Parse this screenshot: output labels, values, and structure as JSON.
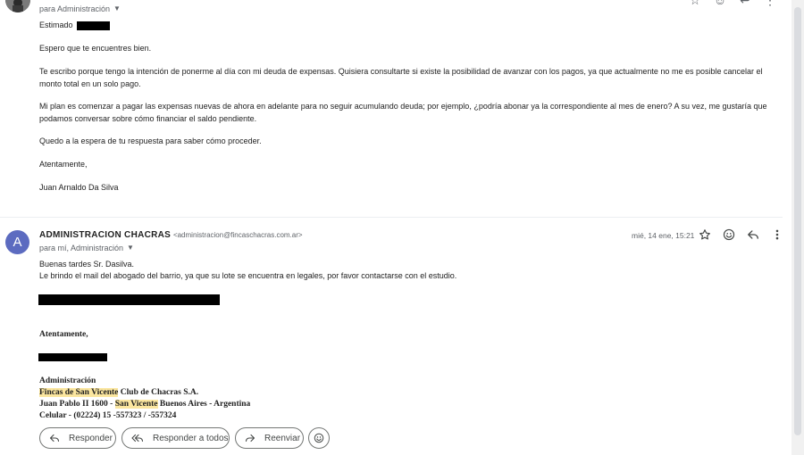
{
  "message1": {
    "recipients_label": "para Administración",
    "greeting": "Estimado",
    "paragraphs": [
      "Espero que te encuentres bien.",
      "Te escribo porque tengo la intención de ponerme al día con mi deuda de expensas. Quisiera consultarte si existe la posibilidad de avanzar con los pagos, ya que actualmente no me es posible cancelar el monto total en un solo pago.",
      "Mi plan es comenzar a pagar las expensas nuevas de ahora en adelante para no seguir acumulando deuda; por ejemplo, ¿podría abonar ya la correspondiente al mes de enero? A su vez, me gustaría que podamos conversar sobre cómo financiar el saldo pendiente.",
      "Quedo a la espera de tu respuesta para saber cómo proceder.",
      "Atentamente,",
      "Juan Arnaldo Da Silva"
    ]
  },
  "message2": {
    "avatar_letter": "A",
    "sender_name": "ADMINISTRACION CHACRAS",
    "sender_email": "<administracion@fincaschacras.com.ar>",
    "recipients_label": "para mí, Administración",
    "date": "mié, 14 ene, 15:21",
    "body_line1": "Buenas tardes Sr. Dasilva.",
    "body_line2": "Le brindo el mail del abogado del barrio, ya que su lote se encuentra en legales, por favor contactarse con el estudio.",
    "closing": "Atentamente,",
    "signature": {
      "title": "Administración",
      "line2_highlight": "Fincas de San Vicente",
      "line2_rest": " Club de Chacras S.A.",
      "line3_start": "Juan Pablo II 1600 - ",
      "line3_highlight": "San Vicente",
      "line3_rest": " Buenos Aires - Argentina",
      "line4": "Celular - (02224) 15 -557323 / -557324"
    }
  },
  "actions": {
    "reply": "Responder",
    "reply_all": "Responder a todos",
    "forward": "Reenviar"
  },
  "icons": [
    "star-icon",
    "emoji-icon",
    "reply-icon",
    "more-vert-icon",
    "reply-all-icon",
    "forward-icon",
    "caret-down-icon"
  ]
}
